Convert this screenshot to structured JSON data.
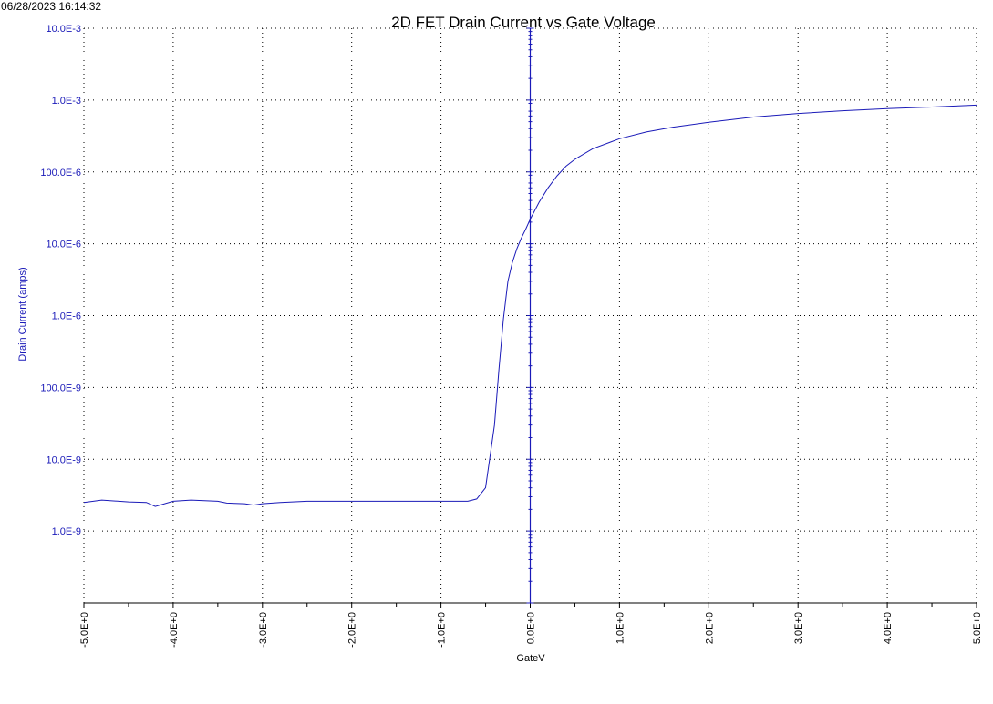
{
  "timestamp": "06/28/2023 16:14:32",
  "colors": {
    "series": "#1a1ab8",
    "yaxis_labels": "#1a1ab8",
    "grid": "#000000",
    "background": "#ffffff"
  },
  "chart_data": {
    "type": "line",
    "title": "2D FET Drain Current vs Gate Voltage",
    "xlabel": "GateV",
    "ylabel": "Drain Current (amps)",
    "xlim": [
      -5,
      5
    ],
    "ylim": [
      1e-10,
      0.01
    ],
    "yscale": "log",
    "grid": true,
    "x_ticks": [
      -5,
      -4,
      -3,
      -2,
      -1,
      0,
      1,
      2,
      3,
      4,
      5
    ],
    "x_tick_labels": [
      "-5.0E+0",
      "-4.0E+0",
      "-3.0E+0",
      "-2.0E+0",
      "-1.0E+0",
      "0.0E+0",
      "1.0E+0",
      "2.0E+0",
      "3.0E+0",
      "4.0E+0",
      "5.0E+0"
    ],
    "y_ticks": [
      1e-09,
      1e-08,
      1e-07,
      1e-06,
      1e-05,
      0.0001,
      0.001,
      0.01
    ],
    "y_tick_labels": [
      "1.0E-9",
      "10.0E-9",
      "100.0E-9",
      "1.0E-6",
      "10.0E-6",
      "100.0E-6",
      "1.0E-3",
      "10.0E-3"
    ],
    "series": [
      {
        "x": [
          -5.0,
          -4.8,
          -4.5,
          -4.3,
          -4.2,
          -4.0,
          -3.8,
          -3.5,
          -3.4,
          -3.2,
          -3.1,
          -3.0,
          -2.8,
          -2.5,
          -2.0,
          -1.5,
          -1.0,
          -0.7,
          -0.6,
          -0.5,
          -0.4,
          -0.35,
          -0.3,
          -0.25,
          -0.2,
          -0.15,
          -0.1,
          -0.05,
          0.0,
          0.1,
          0.2,
          0.3,
          0.4,
          0.5,
          0.7,
          0.9,
          1.0,
          1.3,
          1.6,
          2.0,
          2.5,
          3.0,
          3.5,
          4.0,
          4.5,
          5.0
        ],
        "y": [
          2.5e-09,
          2.7e-09,
          2.55e-09,
          2.5e-09,
          2.2e-09,
          2.6e-09,
          2.7e-09,
          2.6e-09,
          2.45e-09,
          2.4e-09,
          2.3e-09,
          2.4e-09,
          2.5e-09,
          2.6e-09,
          2.6e-09,
          2.6e-09,
          2.6e-09,
          2.6e-09,
          2.8e-09,
          4e-09,
          3e-08,
          1.8e-07,
          9e-07,
          3e-06,
          5.5e-06,
          8.5e-06,
          1.2e-05,
          1.6e-05,
          2.2e-05,
          3.8e-05,
          6e-05,
          8.8e-05,
          0.00012,
          0.00015,
          0.00021,
          0.00026,
          0.00029,
          0.00036,
          0.00042,
          0.00049,
          0.00058,
          0.00065,
          0.00071,
          0.00076,
          0.0008,
          0.00085
        ]
      }
    ]
  }
}
